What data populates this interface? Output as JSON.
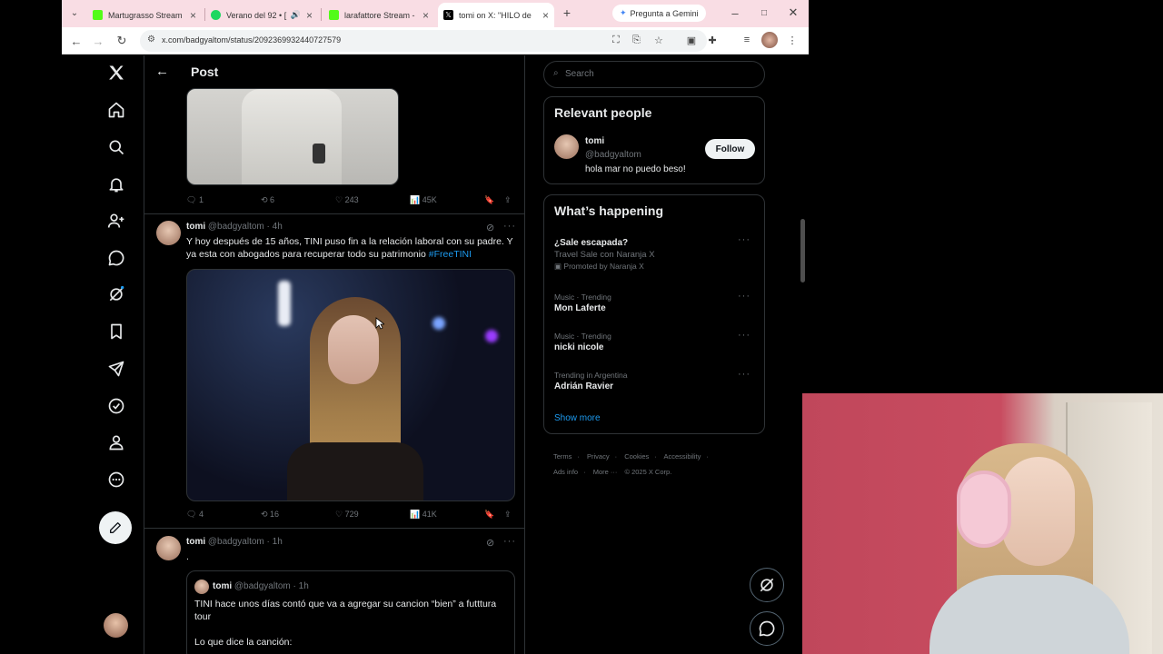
{
  "browser": {
    "tabs": [
      {
        "title": "Martugrasso Stream",
        "favicon_color": "#53fc18"
      },
      {
        "title": "Verano del 92 • [",
        "favicon_color": "#1ed760"
      },
      {
        "title": "larafattore Stream - M",
        "favicon_color": "#53fc18"
      },
      {
        "title": "tomi on X: \"HILO de",
        "favicon_color": "#000000"
      }
    ],
    "gemini_label": "Pregunta a Gemini",
    "url": "x.com/badgyaltom/status/2092369932440727579"
  },
  "header": {
    "title": "Post"
  },
  "tweet_prev": {
    "stats": {
      "replies": "1",
      "reposts": "6",
      "likes": "243",
      "views": "45K"
    }
  },
  "tweet1": {
    "name": "tomi",
    "handle": "@badgyaltom",
    "time": "· 4h",
    "text": "Y hoy después de 15 años, TINI puso fin a la relación laboral con su padre. Y ya esta con abogados para recuperar todo su patrimonio",
    "hashtag": "#FreeTINI",
    "stats": {
      "replies": "4",
      "reposts": "16",
      "likes": "729",
      "views": "41K"
    }
  },
  "tweet2": {
    "name": "tomi",
    "handle": "@badgyaltom",
    "time": "· 1h",
    "text": ".",
    "quote": {
      "name": "tomi",
      "handle": "@badgyaltom",
      "time": "· 1h",
      "text": "TINI hace unos días contó que va a agregar su cancion “bien” a futttura tour",
      "text2": "Lo que dice la canción:"
    }
  },
  "sidebar": {
    "search_placeholder": "Search",
    "relevant": {
      "title": "Relevant people",
      "name": "tomi",
      "handle": "@badgyaltom",
      "bio": "hola mar no puedo beso!",
      "follow_label": "Follow"
    },
    "happening": {
      "title": "What’s happening",
      "promo": {
        "name": "¿Sale escapada?",
        "sub": "Travel Sale con Naranja X",
        "promoted": "Promoted by Naranja X"
      },
      "trends": [
        {
          "context": "Music · Trending",
          "name": "Mon Laferte"
        },
        {
          "context": "Music · Trending",
          "name": "nicki nicole"
        },
        {
          "context": "Trending in Argentina",
          "name": "Adrián Ravier"
        }
      ],
      "show_more": "Show more"
    },
    "footer": [
      "Terms",
      "·",
      "Privacy",
      "·",
      "Cookies",
      "·",
      "Accessibility",
      "·",
      "Ads info",
      "·",
      "More ···",
      "© 2025 X Corp."
    ]
  },
  "colors": {
    "accent": "#1d9bf0",
    "border": "#2f3336",
    "muted": "#71767b",
    "tabstrip": "#f9dde4"
  }
}
